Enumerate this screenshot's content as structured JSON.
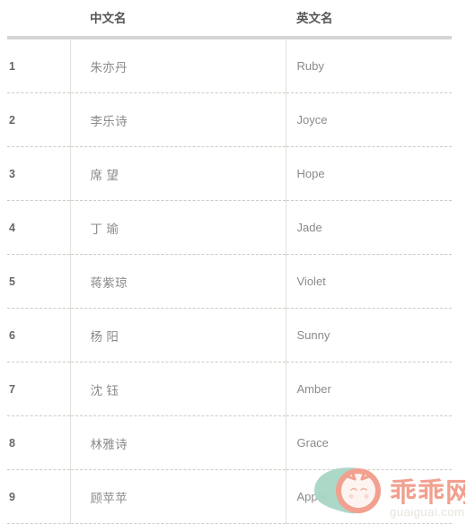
{
  "table": {
    "columns": [
      {
        "key": "index",
        "label": ""
      },
      {
        "key": "chinese",
        "label": "中文名"
      },
      {
        "key": "english",
        "label": "英文名"
      }
    ],
    "rows": [
      {
        "index": "1",
        "chinese": "朱亦丹",
        "english": "Ruby"
      },
      {
        "index": "2",
        "chinese": "李乐诗",
        "english": "Joyce"
      },
      {
        "index": "3",
        "chinese": "席 望",
        "english": "Hope"
      },
      {
        "index": "4",
        "chinese": "丁 瑜",
        "english": "Jade"
      },
      {
        "index": "5",
        "chinese": "蒋紫琼",
        "english": "Violet"
      },
      {
        "index": "6",
        "chinese": "杨 阳",
        "english": "Sunny"
      },
      {
        "index": "7",
        "chinese": "沈 钰",
        "english": "Amber"
      },
      {
        "index": "8",
        "chinese": "林雅诗",
        "english": "Grace"
      },
      {
        "index": "9",
        "chinese": "顾苹苹",
        "english": "Apple"
      }
    ]
  },
  "watermark": {
    "brand_text": "乖乖网",
    "domain_text": "guaiguai.com",
    "brand_color": "#f2a08f",
    "leaf_color": "#a8d6c5",
    "domain_color": "#e8e3dd"
  },
  "colors": {
    "header_text": "#555555",
    "body_text": "#8a8a8a",
    "index_text": "#666666",
    "header_rule": "#d5d5d5",
    "row_separator": "#cfcac2",
    "column_divider": "#e3e0da",
    "background": "#ffffff"
  }
}
